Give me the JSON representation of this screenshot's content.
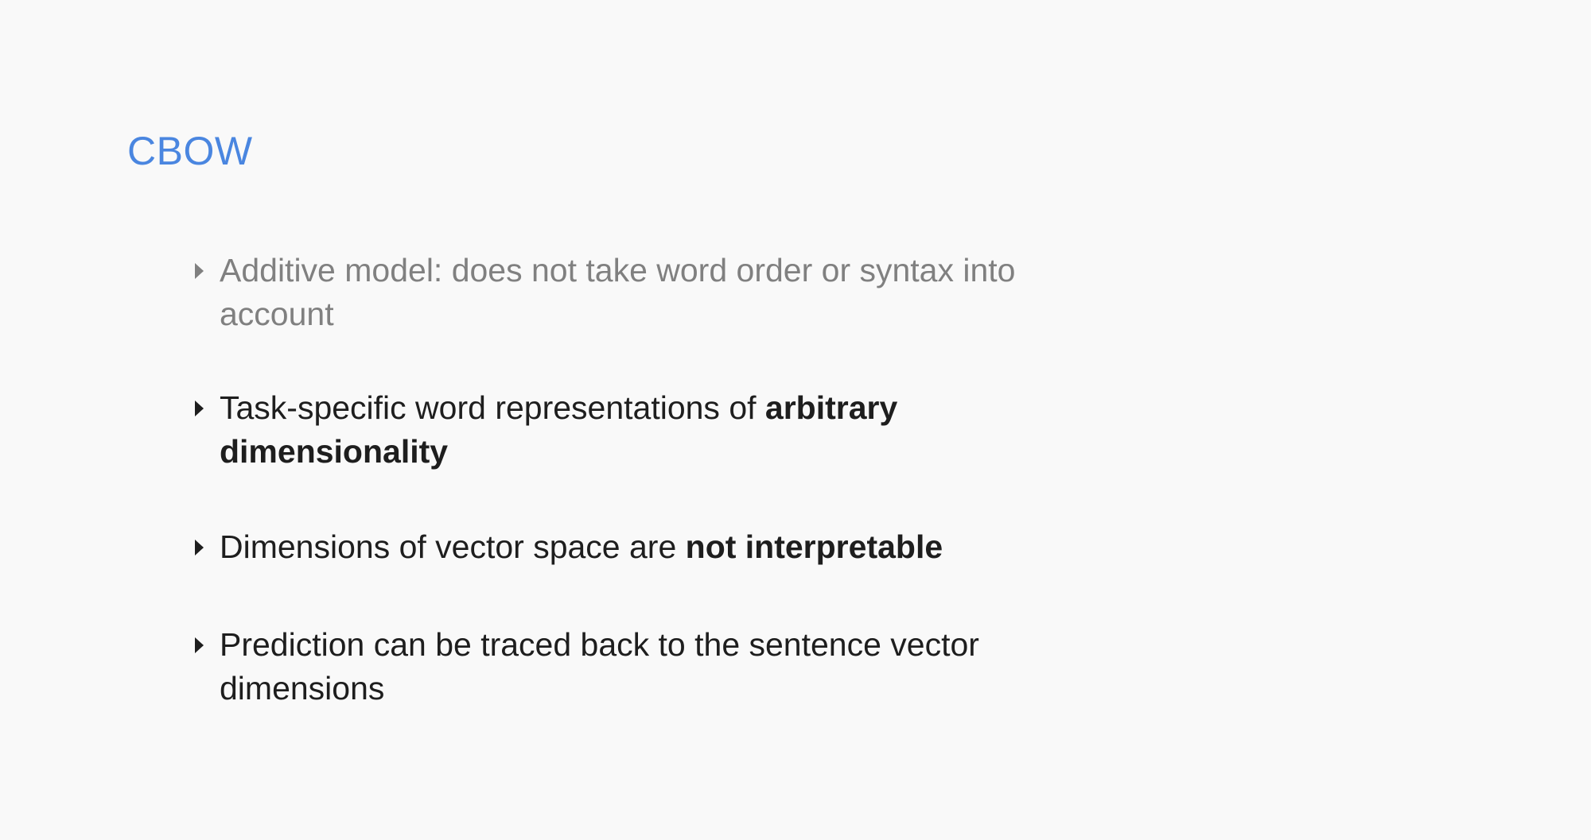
{
  "slide": {
    "title": "CBOW",
    "title_color": "#4a86e0",
    "bullet_icon": "triangle-right-icon",
    "bullets": [
      {
        "state": "dimmed",
        "text": "Additive model: does not take word order or syntax into account",
        "bold": ""
      },
      {
        "state": "normal",
        "text": "Task-specific word representations of ",
        "bold": "arbitrary dimensionality"
      },
      {
        "state": "normal",
        "text": "Dimensions of vector space are ",
        "bold": "not interpretable"
      },
      {
        "state": "normal",
        "text": "Prediction can be traced back to the sentence vector dimensions",
        "bold": ""
      }
    ]
  }
}
